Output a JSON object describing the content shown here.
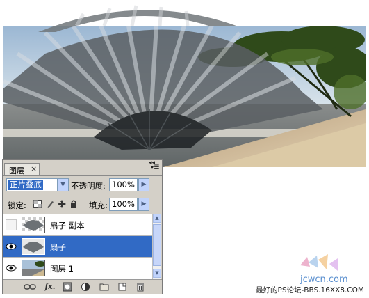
{
  "panel": {
    "tab_label": "图层",
    "tab_close": "×",
    "menu_icon": "panel-menu-icon",
    "blend_mode": "正片叠底",
    "opacity_label": "不透明度:",
    "opacity_value": "100%",
    "lock_label": "锁定:",
    "fill_label": "填充:",
    "fill_value": "100%",
    "lock_icons": [
      "lock-transparent-icon",
      "lock-image-icon",
      "lock-position-icon",
      "lock-all-icon"
    ],
    "layers": [
      {
        "name": "扇子 副本",
        "visible": false,
        "selected": false,
        "thumb": "fan"
      },
      {
        "name": "扇子",
        "visible": true,
        "selected": true,
        "thumb": "fan"
      },
      {
        "name": "图层 1",
        "visible": true,
        "selected": false,
        "thumb": "beach"
      }
    ],
    "bottom_icons": [
      "link-layers-icon",
      "fx-icon",
      "layer-mask-icon",
      "adjustment-layer-icon",
      "new-group-icon",
      "new-layer-icon",
      "delete-layer-icon"
    ],
    "fx_label": "fx."
  },
  "watermark": {
    "text": "最好的PS论坛-BBS.16XX8.COM",
    "logo_text": "jcwcn.com"
  },
  "colors": {
    "selection": "#316ac5",
    "panel_bg": "#d4d0c8",
    "field_border": "#7f9db9"
  }
}
